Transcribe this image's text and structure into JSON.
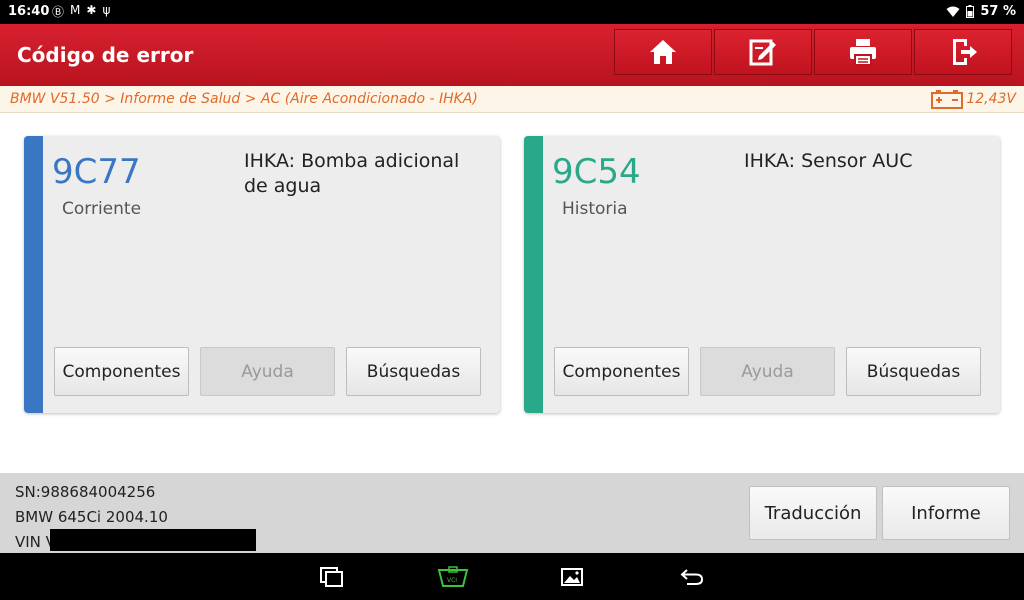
{
  "statusbar": {
    "time": "16:40",
    "icons_left": [
      "b-badge-icon",
      "mail-icon",
      "bluetooth-icon",
      "usb-icon"
    ],
    "battery": "57 %"
  },
  "header": {
    "title": "Código de error",
    "buttons": [
      "home-icon",
      "edit-icon",
      "print-icon",
      "exit-icon"
    ]
  },
  "breadcrumb": {
    "path": "BMW V51.50 > Informe de Salud > AC (Aire Acondicionado - IHKA)",
    "voltage": "12,43V"
  },
  "cards": [
    {
      "code": "9C77",
      "state": "Corriente",
      "description": "IHKA: Bomba adicional de agua",
      "accent": "#3a77c2",
      "buttons": {
        "components": "Componentes",
        "help": "Ayuda",
        "search": "Búsquedas"
      }
    },
    {
      "code": "9C54",
      "state": "Historia",
      "description": "IHKA: Sensor AUC",
      "accent": "#2aa88a",
      "buttons": {
        "components": "Componentes",
        "help": "Ayuda",
        "search": "Búsquedas"
      }
    }
  ],
  "footer": {
    "sn": "SN:988684004256",
    "vehicle": "BMW 645Ci 2004.10",
    "vin_label": "VIN V",
    "translate_label": "Traducción",
    "report_label": "Informe"
  },
  "colors": {
    "header_red": "#cc1a26",
    "breadcrumb_orange": "#e06a2a",
    "current_blue": "#3a77c2",
    "history_green": "#2aa88a"
  }
}
